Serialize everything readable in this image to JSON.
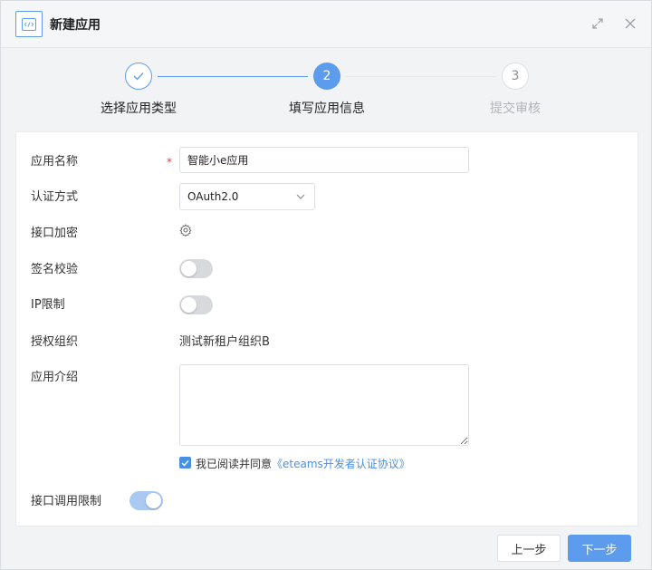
{
  "dialog": {
    "title": "新建应用"
  },
  "steps": [
    {
      "number": "1",
      "label": "选择应用类型",
      "state": "done"
    },
    {
      "number": "2",
      "label": "填写应用信息",
      "state": "active"
    },
    {
      "number": "3",
      "label": "提交审核",
      "state": "pending"
    }
  ],
  "form": {
    "app_name": {
      "label": "应用名称",
      "required_mark": "*",
      "value": "智能小e应用"
    },
    "auth_method": {
      "label": "认证方式",
      "value": "OAuth2.0"
    },
    "api_encryption": {
      "label": "接口加密",
      "icon": "gear-icon"
    },
    "signature_check": {
      "label": "签名校验",
      "enabled": false
    },
    "ip_limit": {
      "label": "IP限制",
      "enabled": false
    },
    "auth_org": {
      "label": "授权组织",
      "value": "测试新租户组织B"
    },
    "app_intro": {
      "label": "应用介绍",
      "value": ""
    },
    "agreement": {
      "checked": true,
      "text": "我已阅读并同意",
      "link": "《eteams开发者认证协议》"
    },
    "api_call_limit": {
      "label": "接口调用限制",
      "enabled": true
    }
  },
  "footer": {
    "prev_label": "上一步",
    "next_label": "下一步"
  },
  "colors": {
    "accent": "#5d9cec",
    "required": "#e23c3c",
    "link": "#4a90e2"
  }
}
